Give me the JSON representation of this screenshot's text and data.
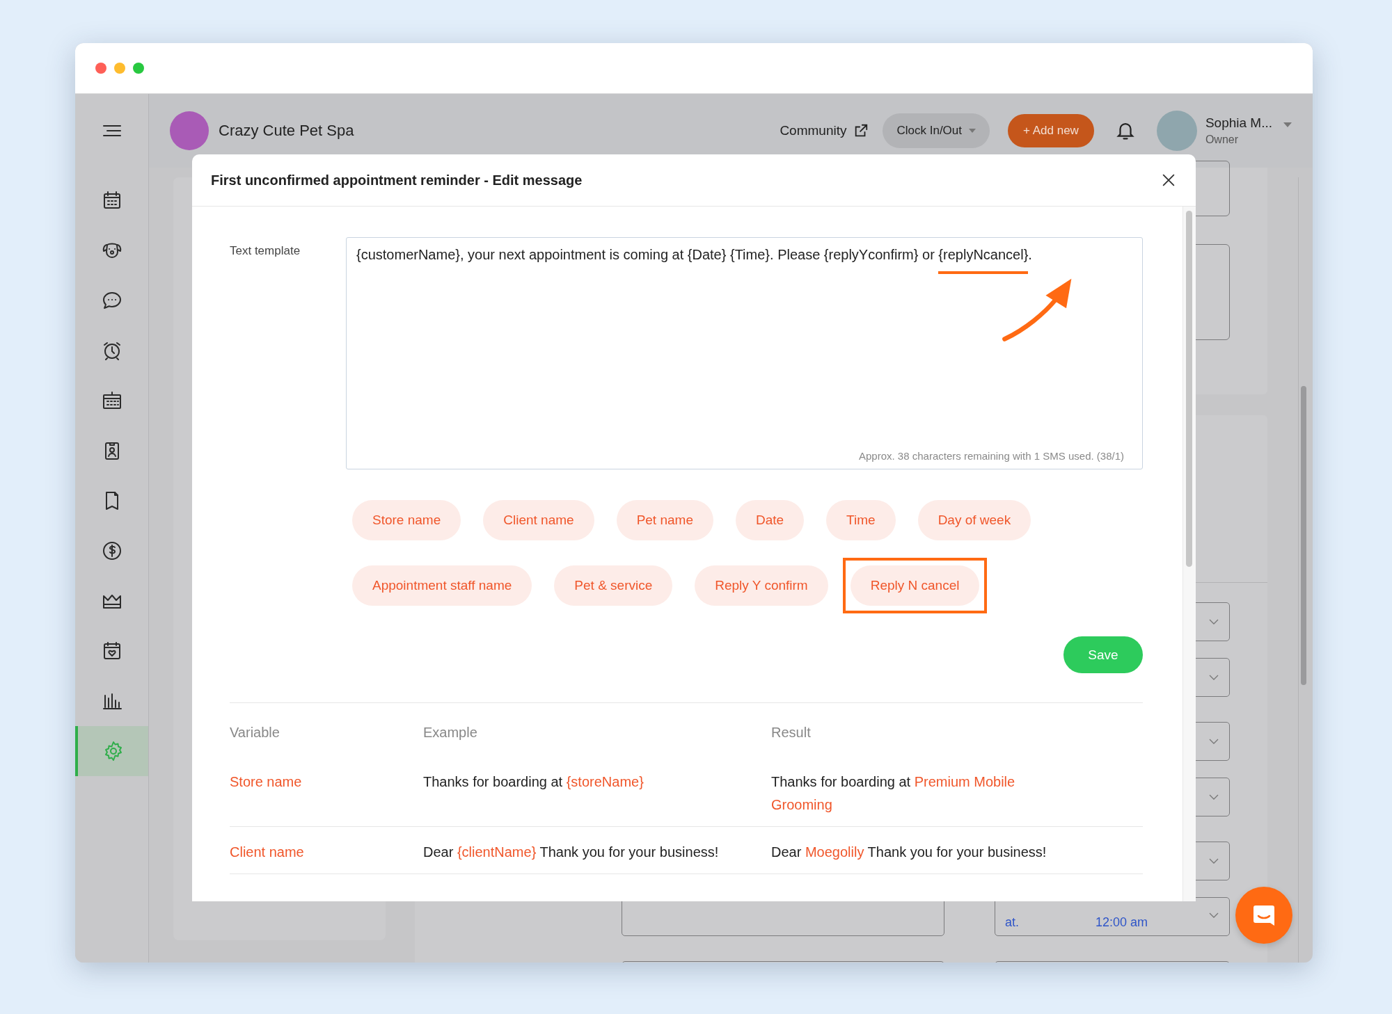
{
  "sidebar": {
    "items": [
      {
        "kind": "menu",
        "selected": false
      },
      {
        "kind": "calendar",
        "selected": false
      },
      {
        "kind": "dog-face",
        "selected": false
      },
      {
        "kind": "chat-bubble",
        "selected": false
      },
      {
        "kind": "alarm-clock",
        "selected": false
      },
      {
        "kind": "calendar-grid",
        "selected": false
      },
      {
        "kind": "id-badge",
        "selected": false
      },
      {
        "kind": "document",
        "selected": false
      },
      {
        "kind": "dollar-coin",
        "selected": false
      },
      {
        "kind": "crown",
        "selected": false
      },
      {
        "kind": "calendar-heart",
        "selected": false
      },
      {
        "kind": "bar-chart",
        "selected": false
      },
      {
        "kind": "gear",
        "selected": true
      }
    ]
  },
  "header": {
    "business_name": "Crazy Cute Pet Spa",
    "community": "Community",
    "clock_button": "Clock In/Out",
    "add_button": "+ Add new",
    "user": {
      "name": "Sophia M...",
      "role": "Owner"
    }
  },
  "background": {
    "time_field": {
      "prefix": "at.",
      "value": "12:00 am"
    }
  },
  "modal": {
    "title": "First unconfirmed appointment reminder - Edit message",
    "template": {
      "label": "Text template",
      "segments": [
        {
          "text": "{customerName}, your next appointment is coming at {Date} {Time}. Please {replyYconfirm} or ",
          "annotated": false
        },
        {
          "text": "{replyNcancel}",
          "annotated": true
        },
        {
          "text": ".",
          "annotated": false
        }
      ],
      "counter": "Approx. 38 characters remaining with 1 SMS used. (38/1)"
    },
    "chips": [
      {
        "label": "Store name",
        "highlighted": false
      },
      {
        "label": "Client name",
        "highlighted": false
      },
      {
        "label": "Pet name",
        "highlighted": false
      },
      {
        "label": "Date",
        "highlighted": false
      },
      {
        "label": "Time",
        "highlighted": false
      },
      {
        "label": "Day of week",
        "highlighted": false
      },
      {
        "label": "Appointment staff name",
        "highlighted": false
      },
      {
        "label": "Pet & service",
        "highlighted": false
      },
      {
        "label": "Reply Y confirm",
        "highlighted": false
      },
      {
        "label": "Reply N cancel",
        "highlighted": true
      }
    ],
    "save_button": "Save",
    "table": {
      "columns": [
        "Variable",
        "Example",
        "Result"
      ],
      "rows": [
        {
          "variable": "Store name",
          "example": [
            {
              "text": "Thanks for boarding at ",
              "highlighted": false
            },
            {
              "text": "{storeName}",
              "highlighted": true
            }
          ],
          "result": [
            {
              "text": "Thanks for boarding at ",
              "highlighted": false
            },
            {
              "text": "Premium Mobile Grooming",
              "highlighted": true
            }
          ]
        },
        {
          "variable": "Client name",
          "example": [
            {
              "text": "Dear ",
              "highlighted": false
            },
            {
              "text": "{clientName}",
              "highlighted": true
            },
            {
              "text": " Thank you for your business!",
              "highlighted": false
            }
          ],
          "result": [
            {
              "text": "Dear ",
              "highlighted": false
            },
            {
              "text": "Moegolily",
              "highlighted": true
            },
            {
              "text": " Thank you for your business!",
              "highlighted": false
            }
          ]
        }
      ]
    }
  }
}
